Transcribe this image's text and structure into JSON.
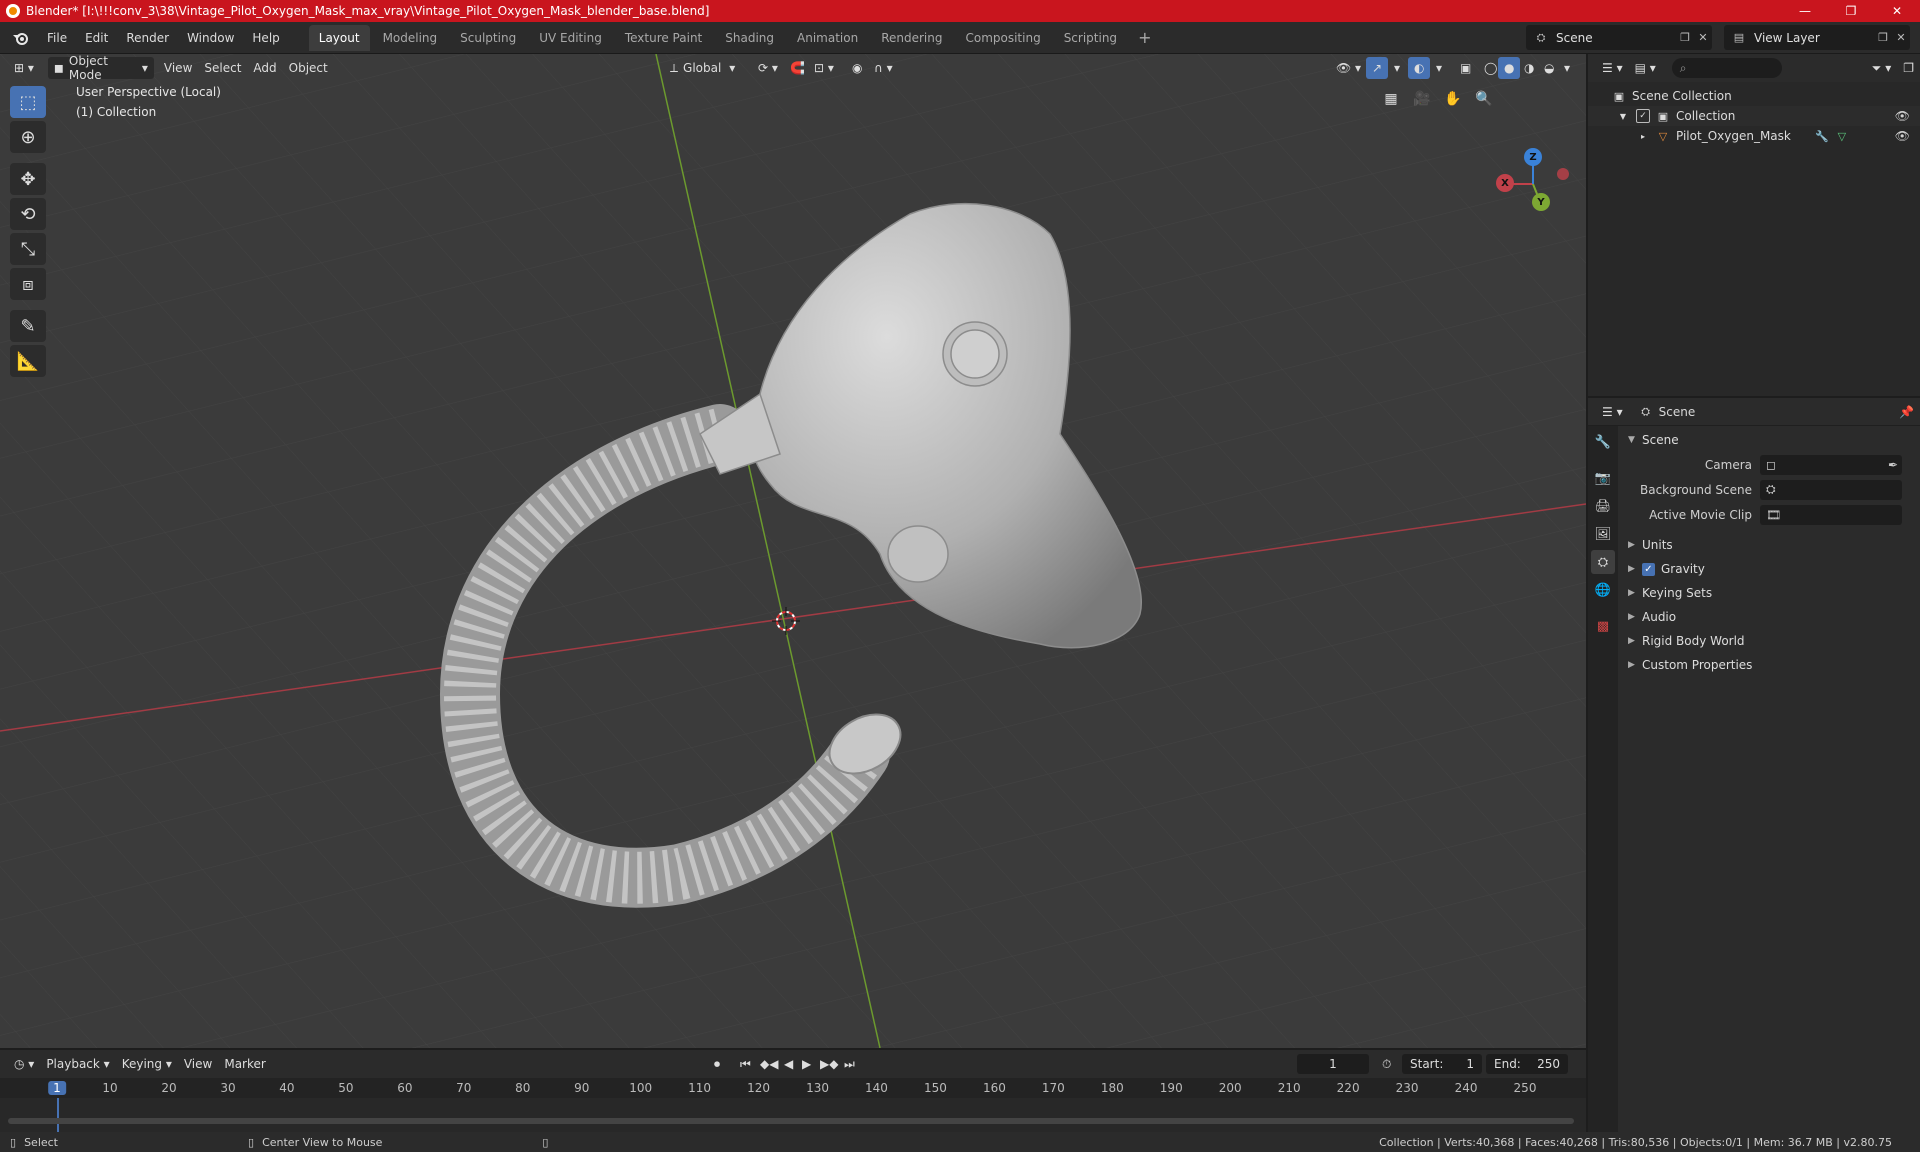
{
  "window": {
    "title": "Blender* [I:\\!!!conv_3\\38\\Vintage_Pilot_Oxygen_Mask_max_vray\\Vintage_Pilot_Oxygen_Mask_blender_base.blend]",
    "minimize": "—",
    "maximize": "❐",
    "close": "✕"
  },
  "menu": [
    "File",
    "Edit",
    "Render",
    "Window",
    "Help"
  ],
  "workspaces": [
    "Layout",
    "Modeling",
    "Sculpting",
    "UV Editing",
    "Texture Paint",
    "Shading",
    "Animation",
    "Rendering",
    "Compositing",
    "Scripting"
  ],
  "scene_selector": "Scene",
  "view_layer_selector": "View Layer",
  "viewport": {
    "mode": "Object Mode",
    "menus": [
      "View",
      "Select",
      "Add",
      "Object"
    ],
    "orientation": "Global",
    "perspective_label": "User Perspective (Local)",
    "collection_label": "(1) Collection",
    "gizmo": {
      "x": "X",
      "y": "Y",
      "z": "Z"
    }
  },
  "outliner": {
    "rows": [
      {
        "label": "Scene Collection"
      },
      {
        "label": "Collection"
      },
      {
        "label": "Pilot_Oxygen_Mask"
      }
    ]
  },
  "properties": {
    "header": "Scene",
    "section": "Scene",
    "fields": [
      {
        "label": "Camera"
      },
      {
        "label": "Background Scene"
      },
      {
        "label": "Active Movie Clip"
      }
    ],
    "panels": [
      "Units",
      "Gravity",
      "Keying Sets",
      "Audio",
      "Rigid Body World",
      "Custom Properties"
    ]
  },
  "timeline": {
    "menus": [
      "Playback",
      "Keying",
      "View",
      "Marker"
    ],
    "current_frame": "1",
    "start_label": "Start:",
    "start": "1",
    "end_label": "End:",
    "end": "250",
    "ticks": [
      "1",
      "10",
      "20",
      "30",
      "40",
      "50",
      "60",
      "70",
      "80",
      "90",
      "100",
      "110",
      "120",
      "130",
      "140",
      "150",
      "160",
      "170",
      "180",
      "190",
      "200",
      "210",
      "220",
      "230",
      "240",
      "250"
    ]
  },
  "statusbar": {
    "select": "Select",
    "center": "Center View to Mouse",
    "stats": "Collection | Verts:40,368 | Faces:40,268 | Tris:80,536 | Objects:0/1 | Mem: 36.7 MB | v2.80.75"
  },
  "colors": {
    "title_bar": "#c9151e",
    "accent": "#4772b3",
    "x_axis": "#c1414a",
    "y_axis": "#7da833",
    "z_axis": "#3a82d8"
  }
}
